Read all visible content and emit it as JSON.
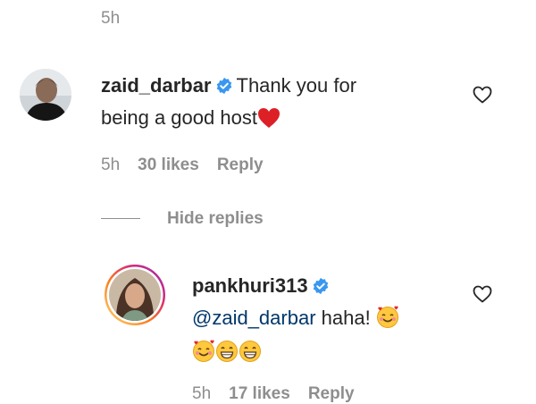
{
  "top": {
    "time": "5h"
  },
  "comment1": {
    "username": "zaid_darbar",
    "text_line1": "Thank you for",
    "text_line2": "being a good host",
    "time": "5h",
    "likes": "30 likes",
    "reply": "Reply"
  },
  "replies": {
    "hide_label": "Hide replies"
  },
  "comment2": {
    "username": "pankhuri313",
    "mention": "@zaid_darbar",
    "text": " haha!",
    "time": "5h",
    "likes": "17 likes",
    "reply": "Reply"
  },
  "colors": {
    "verified": "#3897f0",
    "heart": "#ed4956",
    "meta_text": "#8e8e8e",
    "mention": "#00376b"
  },
  "icons": [
    "verified-badge-icon",
    "heart-outline-icon",
    "red-heart-emoji",
    "smiling-face-with-hearts-emoji",
    "grinning-face-emoji"
  ]
}
